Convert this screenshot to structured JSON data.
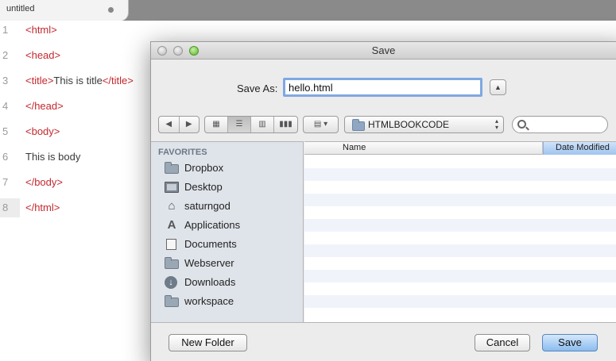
{
  "editor": {
    "tab_title": "untitled",
    "lines": [
      {
        "num": "1",
        "parts": [
          {
            "t": "tag",
            "v": "<html>"
          }
        ]
      },
      {
        "num": "2",
        "parts": [
          {
            "t": "tag",
            "v": "<head>"
          }
        ]
      },
      {
        "num": "3",
        "parts": [
          {
            "t": "tag",
            "v": "<title>"
          },
          {
            "t": "txt",
            "v": "This is title"
          },
          {
            "t": "tag",
            "v": "</title>"
          }
        ]
      },
      {
        "num": "4",
        "parts": [
          {
            "t": "tag",
            "v": "</head>"
          }
        ]
      },
      {
        "num": "5",
        "parts": [
          {
            "t": "tag",
            "v": "<body>"
          }
        ]
      },
      {
        "num": "6",
        "parts": [
          {
            "t": "txt",
            "v": "This is body"
          }
        ]
      },
      {
        "num": "7",
        "parts": [
          {
            "t": "tag",
            "v": "</body>"
          }
        ]
      },
      {
        "num": "8",
        "parts": [
          {
            "t": "tag",
            "v": "</html>"
          }
        ]
      }
    ],
    "active_line": "8"
  },
  "dialog": {
    "title": "Save",
    "save_as_label": "Save As:",
    "filename": "hello.html",
    "location": "HTMLBOOKCODE",
    "search_placeholder": "",
    "sidebar": {
      "heading": "FAVORITES",
      "items": [
        {
          "label": "Dropbox",
          "icon": "folder-icon"
        },
        {
          "label": "Desktop",
          "icon": "desktop-icon"
        },
        {
          "label": "saturngod",
          "icon": "home-icon"
        },
        {
          "label": "Applications",
          "icon": "applications-icon"
        },
        {
          "label": "Documents",
          "icon": "documents-icon"
        },
        {
          "label": "Webserver",
          "icon": "folder-icon"
        },
        {
          "label": "Downloads",
          "icon": "downloads-icon"
        },
        {
          "label": "workspace",
          "icon": "folder-icon"
        }
      ]
    },
    "columns": {
      "name": "Name",
      "date_modified": "Date Modified"
    },
    "buttons": {
      "new_folder": "New Folder",
      "cancel": "Cancel",
      "save": "Save"
    },
    "accent_color": "#8bbcef"
  }
}
